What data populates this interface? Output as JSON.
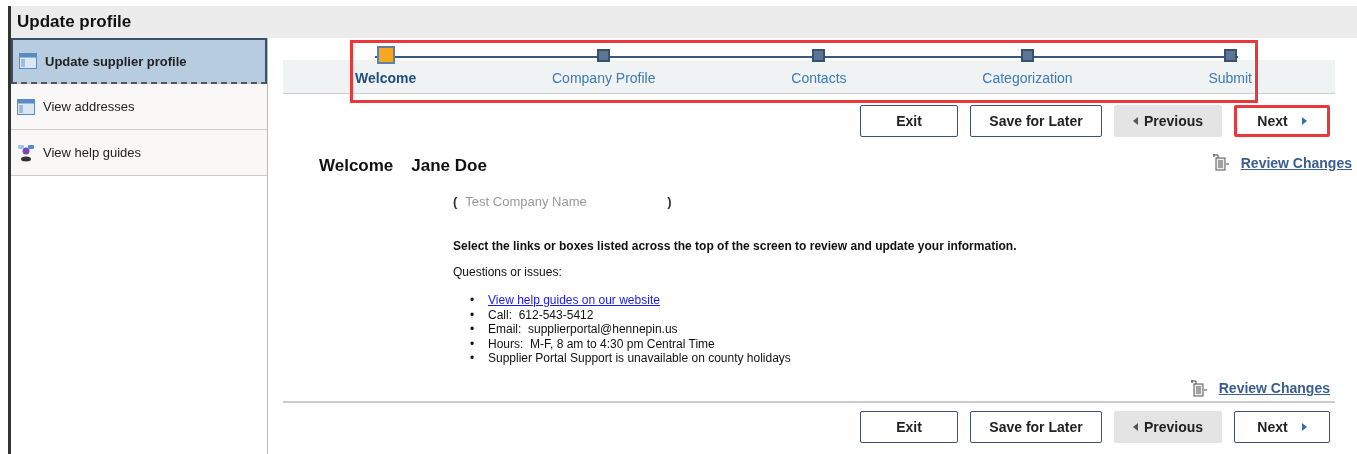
{
  "title": "Update profile",
  "sidebar": {
    "items": [
      {
        "label": "Update supplier profile",
        "kind": "window",
        "selected": true
      },
      {
        "label": "View addresses",
        "kind": "window",
        "selected": false
      },
      {
        "label": "View help guides",
        "kind": "help",
        "selected": false
      }
    ]
  },
  "steps": {
    "highlighted": true,
    "items": [
      {
        "label": "Welcome",
        "selected": true
      },
      {
        "label": "Company Profile",
        "selected": false
      },
      {
        "label": "Contacts",
        "selected": false
      },
      {
        "label": "Categorization",
        "selected": false
      },
      {
        "label": "Submit",
        "selected": false
      }
    ]
  },
  "top_buttons": [
    {
      "label": "Exit",
      "disabled": false,
      "kind": "plain",
      "highlighted": false
    },
    {
      "label": "Save for Later",
      "disabled": false,
      "kind": "plain",
      "highlighted": false
    },
    {
      "label": "Previous",
      "disabled": true,
      "kind": "back",
      "highlighted": false
    },
    {
      "label": "Next",
      "disabled": false,
      "kind": "forward",
      "highlighted": true
    }
  ],
  "welcome": {
    "heading": "Welcome",
    "name": "Jane Doe",
    "company_open": "(",
    "company": "Test Company Name",
    "company_close": ")",
    "review_link": "Review Changes",
    "instruction": "Select the links or boxes listed across the top of the screen to review and update your information.",
    "questions": "Questions or issues:",
    "bullets": [
      {
        "marker": "•",
        "text": "View help guides on our website",
        "kind": "link"
      },
      {
        "marker": "•",
        "text": "Call:  612-543-5412",
        "kind": "text"
      },
      {
        "marker": "•",
        "text": "Email:  supplierportal@hennepin.us",
        "kind": "text"
      },
      {
        "marker": "•",
        "text": "Hours:  M-F, 8 am to 4:30 pm Central Time",
        "kind": "text"
      },
      {
        "marker": "•",
        "text": "Supplier Portal Support is unavailable on county holidays",
        "kind": "text"
      }
    ]
  },
  "bottom_review_link": "Review Changes",
  "bottom_buttons": [
    {
      "label": "Exit",
      "disabled": false,
      "kind": "plain",
      "highlighted": false
    },
    {
      "label": "Save for Later",
      "disabled": false,
      "kind": "plain",
      "highlighted": false
    },
    {
      "label": "Previous",
      "disabled": true,
      "kind": "back",
      "highlighted": false
    },
    {
      "label": "Next",
      "disabled": false,
      "kind": "forward",
      "highlighted": false
    }
  ]
}
